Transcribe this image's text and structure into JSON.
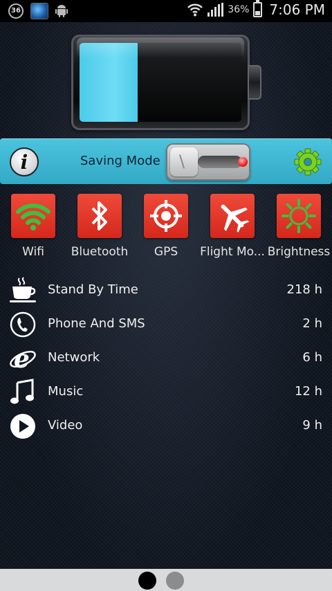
{
  "status_bar": {
    "notification_badge": "36",
    "battery_percent": "36%",
    "time": "7:06 PM",
    "icons": [
      "badge-circle-icon",
      "globe-app-icon",
      "android-icon",
      "wifi-icon",
      "signal-icon",
      "battery-icon"
    ]
  },
  "battery": {
    "level_fraction": 0.36,
    "fill_color": "#4ccbea"
  },
  "saving_mode": {
    "label": "Saving Mode",
    "enabled": false,
    "banner_color": "#3fb8d3",
    "icons": [
      "info-icon",
      "gear-icon"
    ]
  },
  "quick_toggles": [
    {
      "label": "Wifi",
      "icon": "wifi-icon",
      "icon_color": "#3fbf3f"
    },
    {
      "label": "Bluetooth",
      "icon": "bluetooth-icon",
      "icon_color": "#ffffff"
    },
    {
      "label": "GPS",
      "icon": "gps-target-icon",
      "icon_color": "#ffffff"
    },
    {
      "label": "Flight Mo...",
      "icon": "airplane-icon",
      "icon_color": "#ffffff"
    },
    {
      "label": "Brightness",
      "icon": "sun-icon",
      "icon_color": "#3fbf3f"
    }
  ],
  "usage": [
    {
      "label": "Stand By Time",
      "value": "218 h",
      "icon": "coffee-cup-icon"
    },
    {
      "label": "Phone And SMS",
      "value": "2 h",
      "icon": "phone-icon"
    },
    {
      "label": "Network",
      "value": "6 h",
      "icon": "internet-explorer-icon"
    },
    {
      "label": "Music",
      "value": "12 h",
      "icon": "music-note-icon"
    },
    {
      "label": "Video",
      "value": "9 h",
      "icon": "play-icon"
    }
  ],
  "pager": {
    "pages": 2,
    "active": 1,
    "active_color": "#000000",
    "inactive_color": "#8c8c8c"
  },
  "colors": {
    "tile_red": "#e0392b",
    "accent_cyan": "#3fb8d3"
  }
}
